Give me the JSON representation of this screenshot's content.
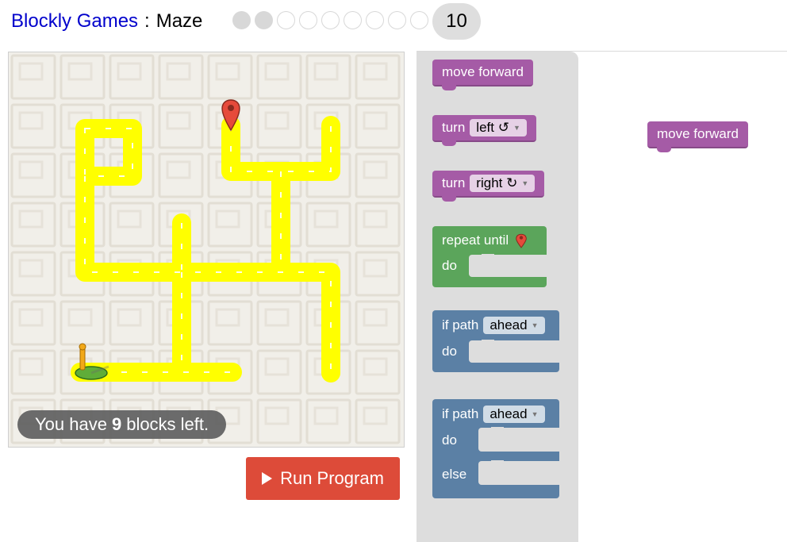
{
  "header": {
    "app_title": "Blockly Games",
    "separator": ":",
    "level_name": "Maze",
    "levels_total": 10,
    "levels_completed": 2,
    "current_level": "10"
  },
  "maze": {
    "capacity_prefix": "You have",
    "capacity_count": "9",
    "capacity_suffix": "blocks left.",
    "colors": {
      "path": "#ffff00",
      "background": "#f1efe9",
      "marker": "#e64a3b",
      "pegman_base": "#5fad39"
    }
  },
  "run_button": {
    "label": "Run Program",
    "icon": "play-icon"
  },
  "toolbox": {
    "move_forward": "move forward",
    "turn_left": {
      "label": "turn",
      "option": "left ↺"
    },
    "turn_right": {
      "label": "turn",
      "option": "right ↻"
    },
    "repeat_until": {
      "label": "repeat until",
      "icon": "map-marker-icon",
      "do": "do"
    },
    "if_path": {
      "label": "if path",
      "option": "ahead",
      "do": "do"
    },
    "if_else_path": {
      "label": "if path",
      "option": "ahead",
      "do": "do",
      "else": "else"
    }
  },
  "workspace": {
    "blocks": [
      {
        "label": "move forward"
      }
    ]
  },
  "colors": {
    "move": "#a55ba6",
    "loop": "#5ba55b",
    "logic": "#5b80a5",
    "run": "#dd4b39"
  }
}
